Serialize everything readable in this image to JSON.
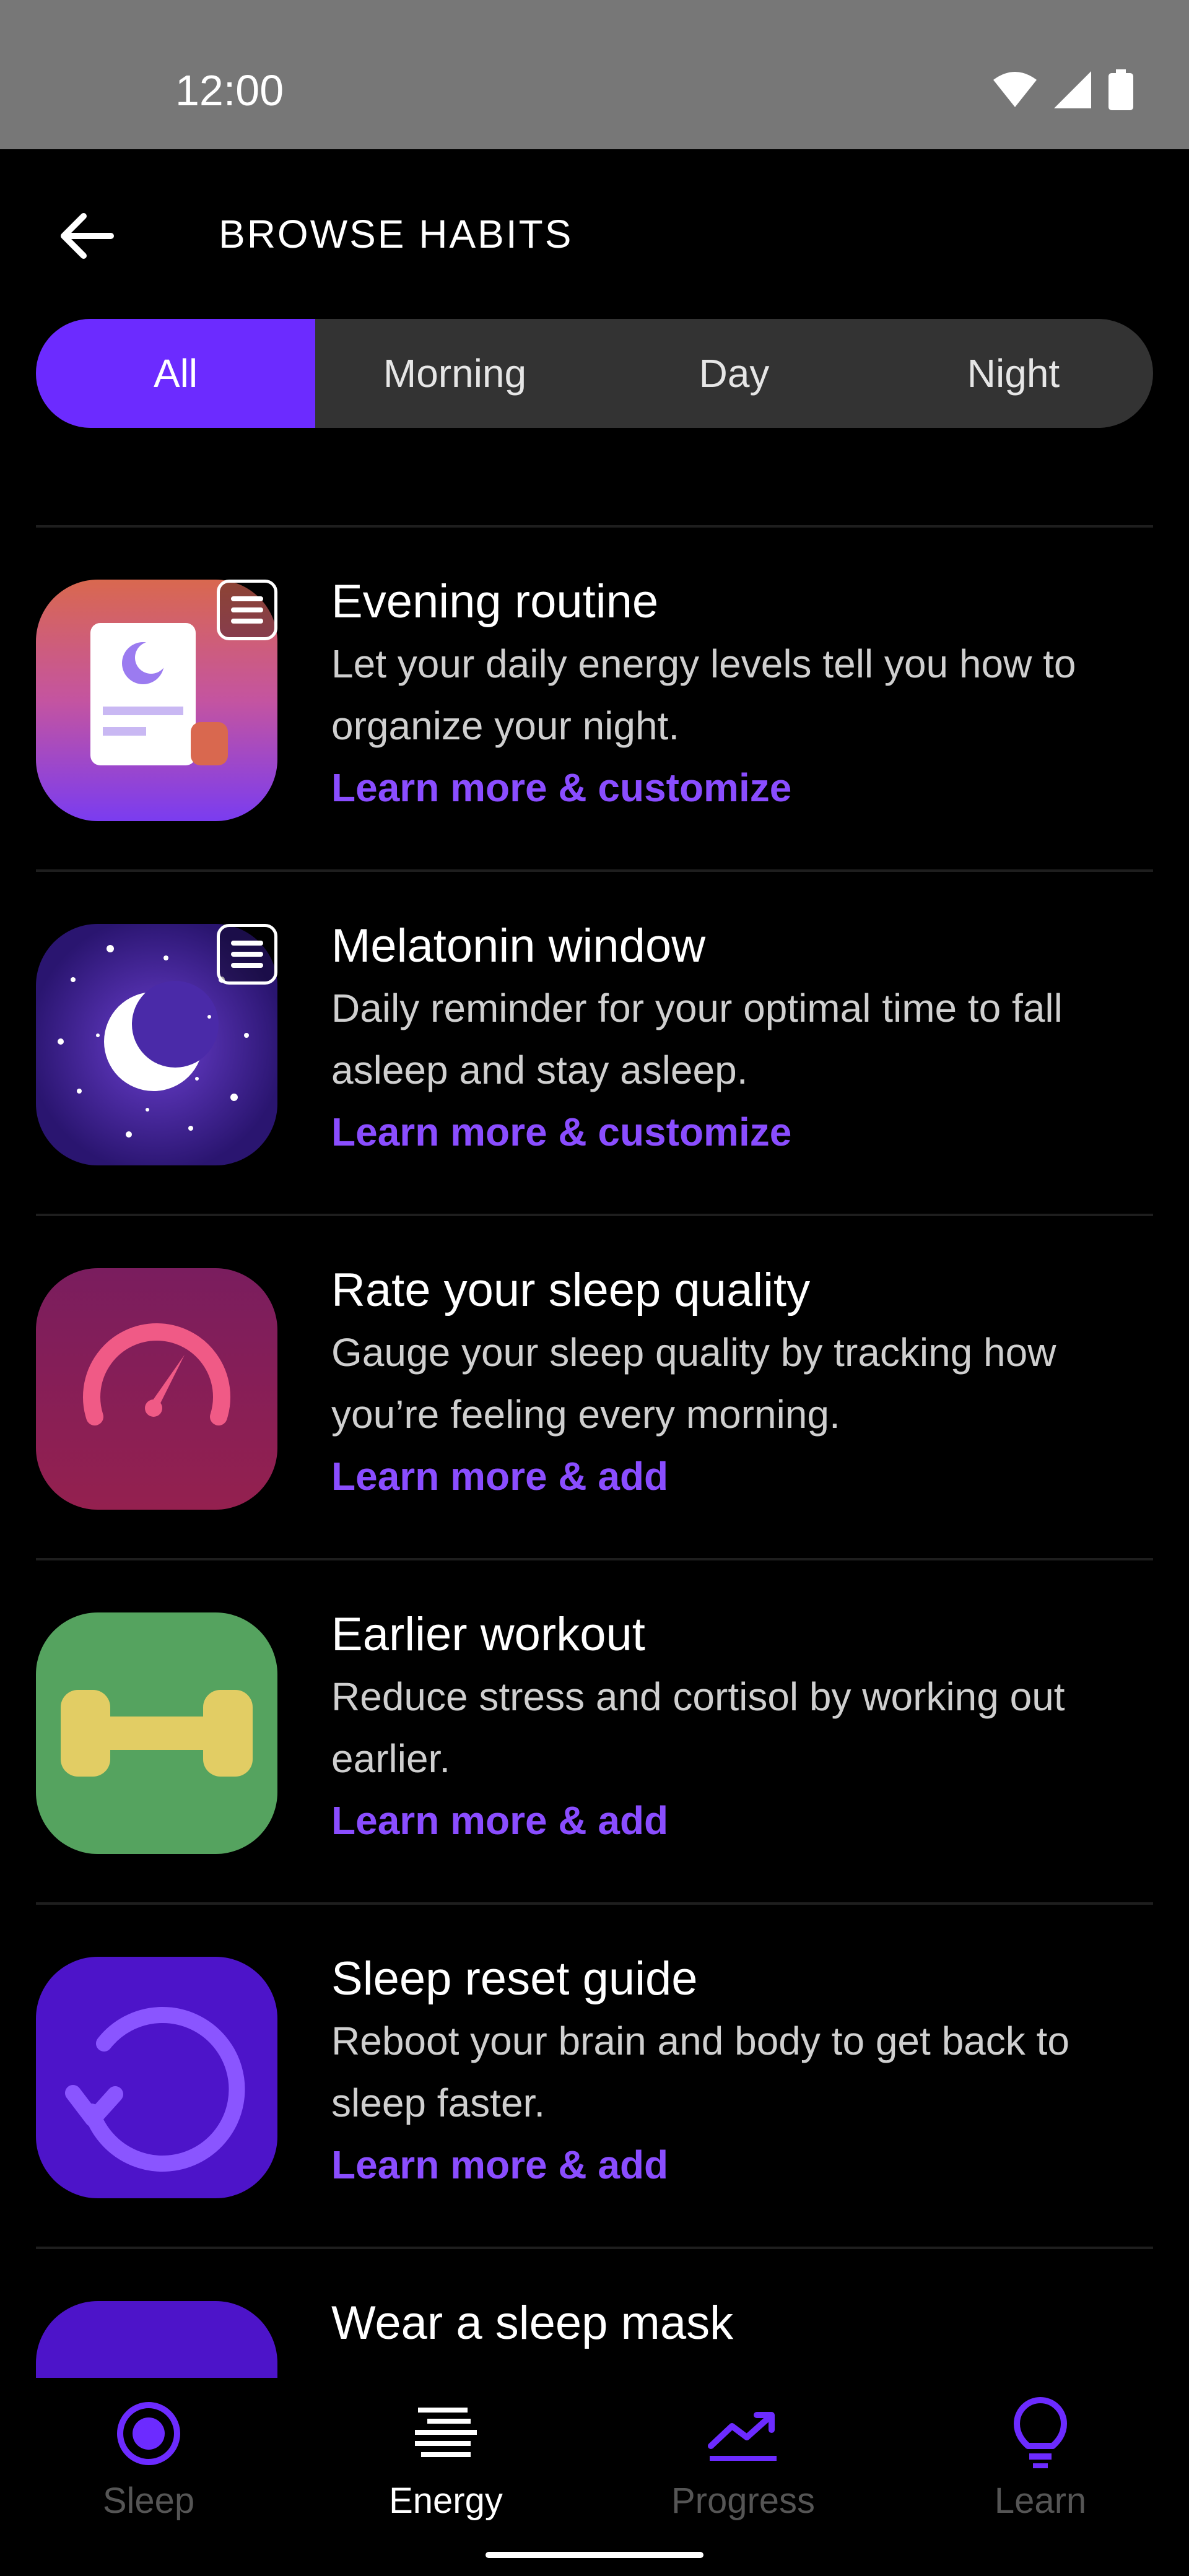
{
  "status_bar": {
    "time": "12:00"
  },
  "header": {
    "title": "BROWSE HABITS"
  },
  "filters": {
    "options": [
      "All",
      "Morning",
      "Day",
      "Night"
    ],
    "selected": "All"
  },
  "habits": [
    {
      "title": "Evening routine",
      "description": "Let your daily energy levels tell you how to organize your night.",
      "link": "Learn more & customize",
      "icon": "evening-routine-icon"
    },
    {
      "title": "Melatonin window",
      "description": "Daily reminder for your optimal time to fall asleep and stay asleep.",
      "link": "Learn more & customize",
      "icon": "moon-icon"
    },
    {
      "title": "Rate your sleep quality",
      "description": "Gauge your sleep quality by tracking how you’re feeling every morning.",
      "link": "Learn more & add",
      "icon": "gauge-icon"
    },
    {
      "title": "Earlier workout",
      "description": "Reduce stress and cortisol by working out earlier.",
      "link": "Learn more & add",
      "icon": "dumbbell-icon"
    },
    {
      "title": "Sleep reset guide",
      "description": "Reboot your brain and body to get back to sleep faster.",
      "link": "Learn more & add",
      "icon": "reset-icon"
    },
    {
      "title": "Wear a sleep mask",
      "description": "",
      "link": "",
      "icon": "sleep-mask-icon"
    }
  ],
  "bottom_nav": {
    "items": [
      {
        "label": "Sleep",
        "icon": "sleep-icon"
      },
      {
        "label": "Energy",
        "icon": "energy-icon"
      },
      {
        "label": "Progress",
        "icon": "progress-icon"
      },
      {
        "label": "Learn",
        "icon": "lightbulb-icon"
      }
    ],
    "active": "Energy"
  },
  "colors": {
    "accent": "#6c2bff",
    "link": "#8a4dff",
    "background": "#000000",
    "status_bar": "#777777"
  }
}
